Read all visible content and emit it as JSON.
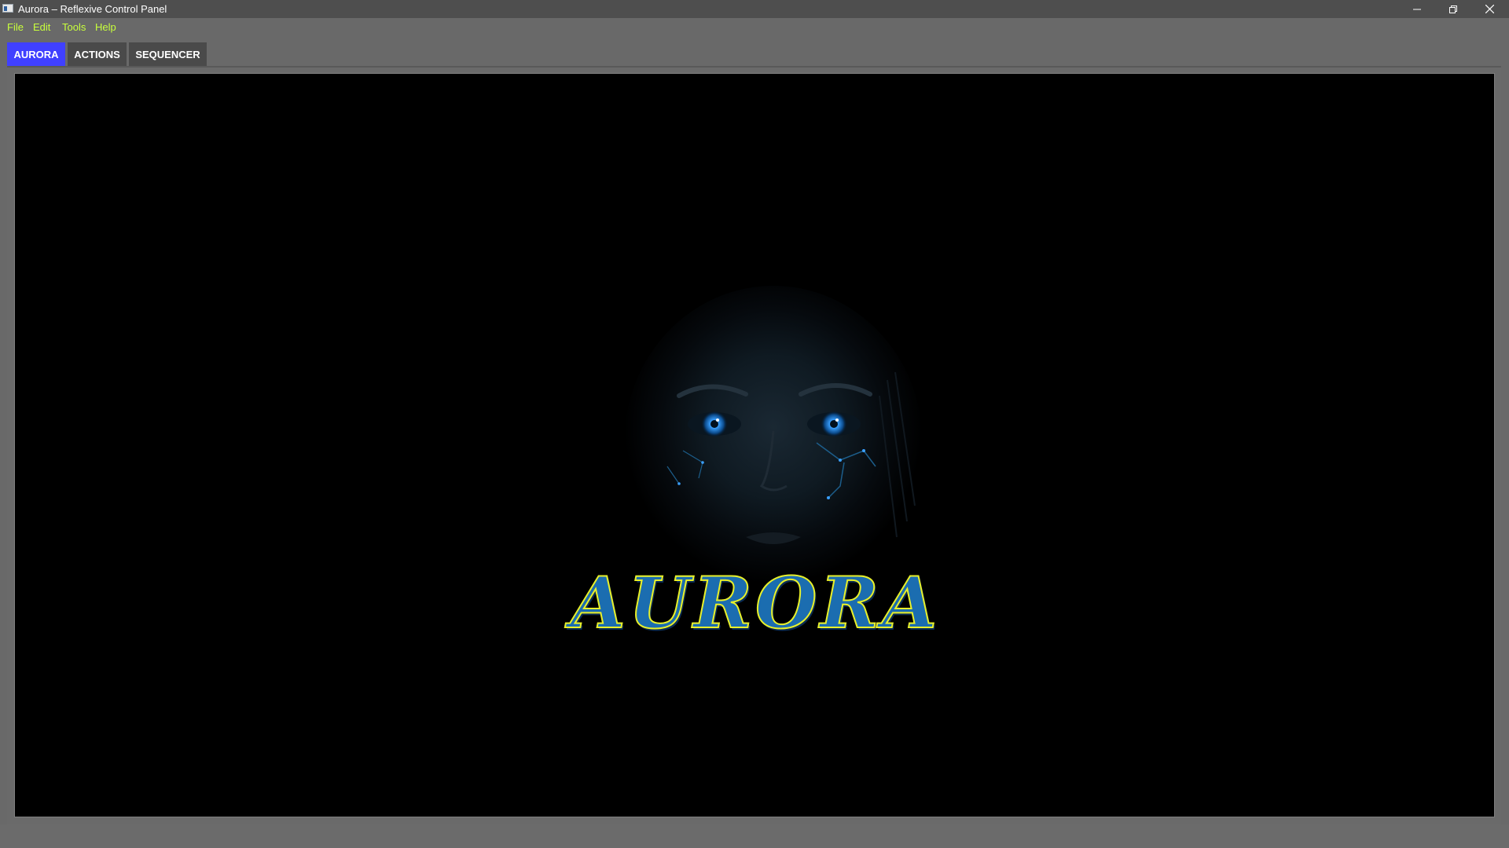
{
  "window": {
    "title": "Aurora – Reflexive Control Panel",
    "icon": "app-window-icon",
    "controls": [
      "minimize-icon",
      "restore-icon",
      "close-icon"
    ]
  },
  "menubar": {
    "items": [
      "File",
      "Edit",
      "Tools",
      "Help"
    ],
    "color": "#c8ff3c"
  },
  "tabs": [
    {
      "label": "AURORA",
      "active": true
    },
    {
      "label": "ACTIONS",
      "active": false
    },
    {
      "label": "SEQUENCER",
      "active": false
    }
  ],
  "colors": {
    "active_tab": "#4040ff",
    "inactive_tab": "#4a4a4a",
    "canvas": "#000000",
    "brand_fill": "#1b6db0",
    "brand_outline": "#e8f02a",
    "eye_glow": "#3aa0ff"
  },
  "splash": {
    "brand": "AURORA",
    "image": "cyborg-face"
  }
}
